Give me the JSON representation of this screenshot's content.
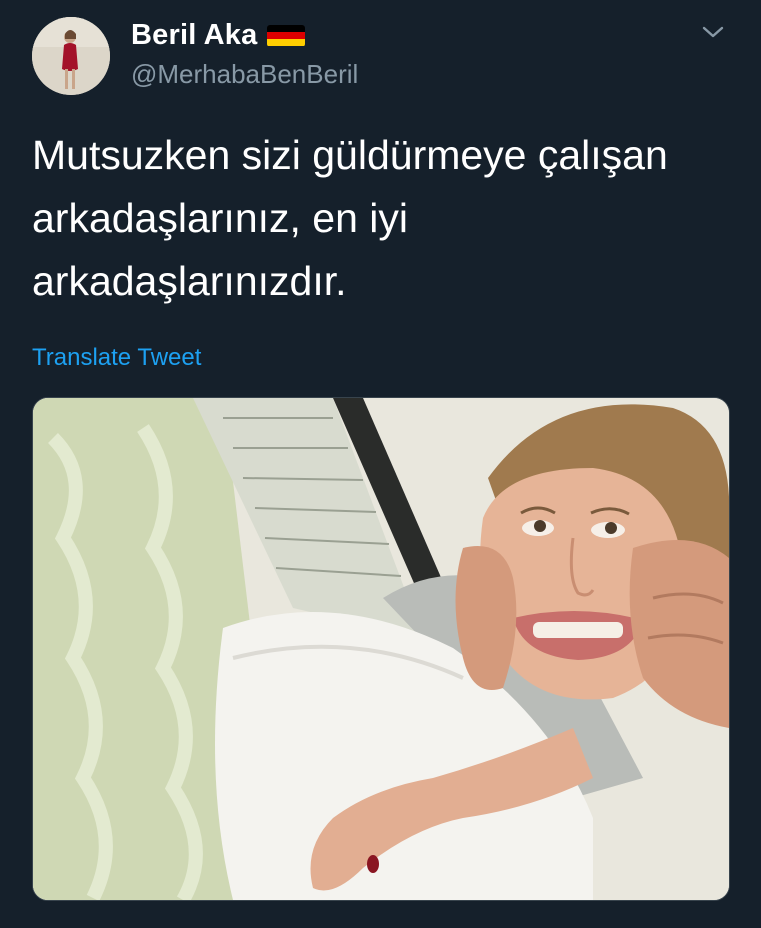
{
  "tweet": {
    "display_name": "Beril Aka",
    "handle": "@MerhabaBenBeril",
    "flag_icon": "germany-flag-icon",
    "menu_icon": "chevron-down-icon",
    "text": "Mutsuzken sizi güldürmeye çalışan arkadaşlarınız, en iyi arkadaşlarınızdır.",
    "translate_label": "Translate Tweet",
    "media": {
      "description": "Photo attachment"
    }
  },
  "colors": {
    "background": "#15202b",
    "primary_text": "#ffffff",
    "secondary_text": "#8899a6",
    "link": "#1da1f2",
    "flag_black": "#000000",
    "flag_red": "#dd0000",
    "flag_gold": "#ffce00"
  }
}
